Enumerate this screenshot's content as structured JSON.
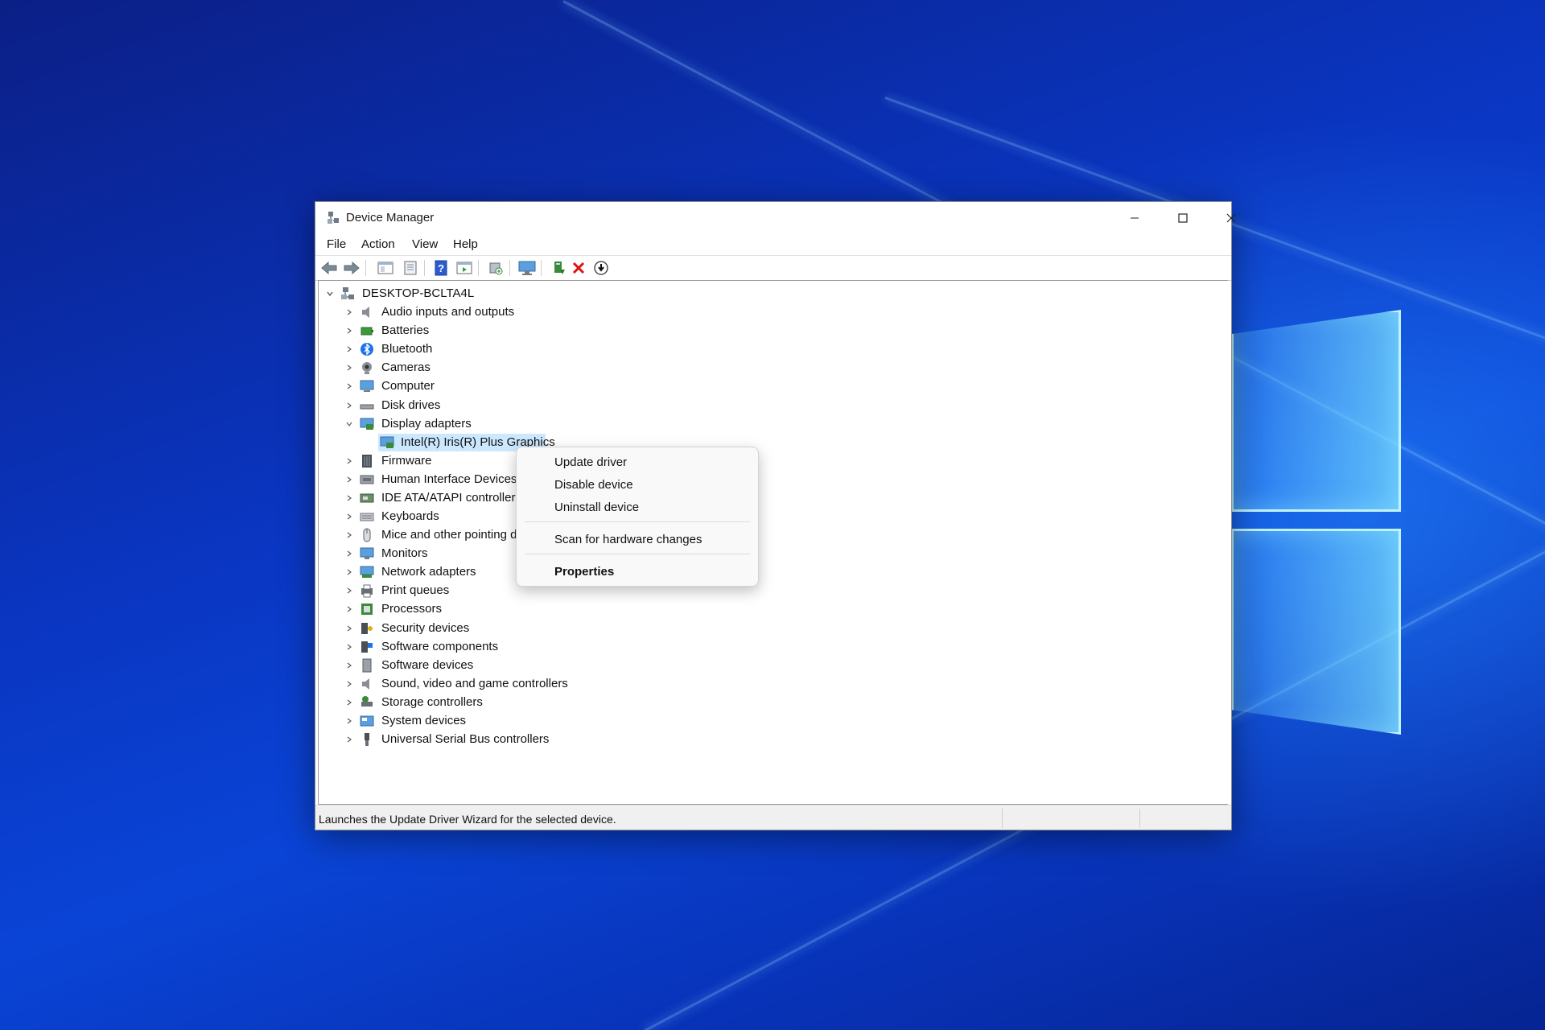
{
  "window": {
    "title": "Device Manager",
    "app_icon": "device-manager-icon",
    "controls": {
      "minimize": "minimize-icon",
      "maximize": "maximize-icon",
      "close": "close-icon"
    }
  },
  "menu": [
    "File",
    "Action",
    "View",
    "Help"
  ],
  "toolbar": {
    "icons": [
      "back-icon",
      "forward-icon",
      "show-hide-console-tree-icon",
      "properties-icon",
      "help-icon",
      "action-pane-icon",
      "scan-hardware-icon",
      "monitor-icon",
      "update-driver-icon",
      "uninstall-icon",
      "download-icon"
    ]
  },
  "tree": {
    "root": "DESKTOP-BCLTA4L",
    "categories": [
      {
        "label": "Audio inputs and outputs",
        "icon": "speaker-icon",
        "expanded": false
      },
      {
        "label": "Batteries",
        "icon": "battery-icon",
        "expanded": false
      },
      {
        "label": "Bluetooth",
        "icon": "bluetooth-icon",
        "expanded": false
      },
      {
        "label": "Cameras",
        "icon": "camera-icon",
        "expanded": false
      },
      {
        "label": "Computer",
        "icon": "computer-icon",
        "expanded": false
      },
      {
        "label": "Disk drives",
        "icon": "disk-drive-icon",
        "expanded": false
      },
      {
        "label": "Display adapters",
        "icon": "display-adapter-icon",
        "expanded": true,
        "children": [
          "Intel(R) Iris(R) Plus Graphics"
        ]
      },
      {
        "label": "Firmware",
        "icon": "firmware-icon",
        "expanded": false
      },
      {
        "label": "Human Interface Devices",
        "icon": "hid-icon",
        "expanded": false
      },
      {
        "label": "IDE ATA/ATAPI controllers",
        "icon": "ide-controller-icon",
        "expanded": false
      },
      {
        "label": "Keyboards",
        "icon": "keyboard-icon",
        "expanded": false
      },
      {
        "label": "Mice and other pointing devices",
        "icon": "mouse-icon",
        "expanded": false
      },
      {
        "label": "Monitors",
        "icon": "monitor-icon",
        "expanded": false
      },
      {
        "label": "Network adapters",
        "icon": "network-adapter-icon",
        "expanded": false
      },
      {
        "label": "Print queues",
        "icon": "printer-icon",
        "expanded": false
      },
      {
        "label": "Processors",
        "icon": "processor-icon",
        "expanded": false
      },
      {
        "label": "Security devices",
        "icon": "security-device-icon",
        "expanded": false
      },
      {
        "label": "Software components",
        "icon": "software-component-icon",
        "expanded": false
      },
      {
        "label": "Software devices",
        "icon": "software-device-icon",
        "expanded": false
      },
      {
        "label": "Sound, video and game controllers",
        "icon": "sound-icon",
        "expanded": false
      },
      {
        "label": "Storage controllers",
        "icon": "storage-controller-icon",
        "expanded": false
      },
      {
        "label": "System devices",
        "icon": "system-device-icon",
        "expanded": false
      },
      {
        "label": "Universal Serial Bus controllers",
        "icon": "usb-icon",
        "expanded": false
      }
    ]
  },
  "context_menu": {
    "items": [
      "Update driver",
      "Disable device",
      "Uninstall device",
      "Scan for hardware changes",
      "Properties"
    ]
  },
  "statusbar": {
    "text": "Launches the Update Driver Wizard for the selected device."
  },
  "colors": {
    "selection": "#cce8ff",
    "desktop_blue": "#0a36c2",
    "glow": "#5fd6ff"
  }
}
